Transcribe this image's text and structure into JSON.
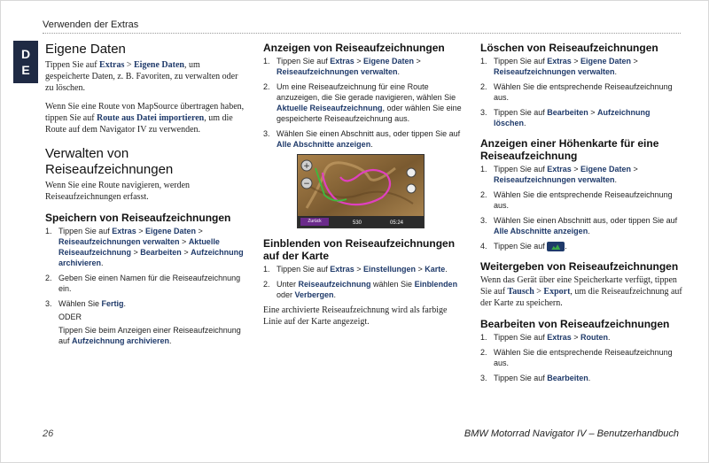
{
  "header": {
    "section": "Verwenden der Extras"
  },
  "lang_tab": {
    "line1": "D",
    "line2": "E"
  },
  "col1": {
    "h_eigene": "Eigene Daten",
    "p1_a": "Tippen Sie auf ",
    "p1_k1": "Extras",
    "p1_sep": " > ",
    "p1_k2": "Eigene Daten",
    "p1_b": ", um gespeicherte Daten, z. B. Favoriten, zu verwalten oder zu löschen.",
    "p2_a": "Wenn Sie eine Route von MapSource übertragen haben, tippen Sie auf ",
    "p2_k": "Route aus Datei importieren",
    "p2_b": ", um die Route auf dem Navigator IV zu verwenden.",
    "h_verwalten": "Verwalten von Reiseaufzeichnungen",
    "p3": "Wenn Sie eine Route navigieren, werden Reiseaufzeichnungen erfasst.",
    "h_speichern": "Speichern von Reiseaufzeichnungen",
    "s1_n": "1.",
    "s1_a": "Tippen Sie auf ",
    "s1_k1": "Extras",
    "s1_k2": "Eigene Daten",
    "s1_k3": "Reiseaufzeichnungen verwalten",
    "s1_k4": "Aktuelle Reiseaufzeichnung",
    "s1_k5": "Bearbeiten",
    "s1_k6": "Aufzeichnung archivieren",
    "s1_end": ".",
    "s2_n": "2.",
    "s2": "Geben Sie einen Namen für die Reiseaufzeichnung ein.",
    "s3_n": "3.",
    "s3_a": "Wählen Sie ",
    "s3_k": "Fertig",
    "s3_end": ".",
    "s3_oder": "ODER",
    "s3_alt_a": "Tippen Sie beim Anzeigen einer Reiseaufzeichnung auf ",
    "s3_alt_k": "Aufzeichnung archivieren",
    "s3_alt_end": "."
  },
  "col2": {
    "h_anzeigen": "Anzeigen von Reiseaufzeichnungen",
    "a1_n": "1.",
    "a1_a": "Tippen Sie auf ",
    "a1_k1": "Extras",
    "a1_k2": "Eigene Daten",
    "a1_k3": "Reiseaufzeichnungen verwalten",
    "a1_end": ".",
    "a2_n": "2.",
    "a2_a": "Um eine Reiseaufzeichnung für eine Route anzuzeigen, die Sie gerade navigieren, wählen Sie ",
    "a2_k": "Aktuelle Reiseaufzeichnung",
    "a2_b": ", oder wählen Sie eine gespeicherte Reiseaufzeichnung aus.",
    "a3_n": "3.",
    "a3_a": "Wählen Sie einen Abschnitt aus, oder tippen Sie auf ",
    "a3_k": "Alle Abschnitte anzeigen",
    "a3_end": ".",
    "map_btn": "Zurück",
    "map_val1": "530",
    "map_val2": "05:24",
    "h_einblenden": "Einblenden von Reiseaufzeichnungen auf der Karte",
    "e1_n": "1.",
    "e1_a": "Tippen Sie auf ",
    "e1_k1": "Extras",
    "e1_k2": "Einstellungen",
    "e1_k3": "Karte",
    "e1_end": ".",
    "e2_n": "2.",
    "e2_a": "Unter ",
    "e2_k1": "Reiseaufzeichnung",
    "e2_b": " wählen Sie ",
    "e2_k2": "Einblenden",
    "e2_c": " oder ",
    "e2_k3": "Verbergen",
    "e2_end": ".",
    "p_archiv": "Eine archivierte Reiseaufzeichnung wird als farbige Linie auf der Karte angezeigt."
  },
  "col3": {
    "h_loeschen": "Löschen von Reiseaufzeichnungen",
    "l1_n": "1.",
    "l1_a": "Tippen Sie auf ",
    "l1_k1": "Extras",
    "l1_k2": "Eigene Daten",
    "l1_k3": "Reiseaufzeichnungen verwalten",
    "l1_end": ".",
    "l2_n": "2.",
    "l2": "Wählen Sie die entsprechende Reiseaufzeichnung aus.",
    "l3_n": "3.",
    "l3_a": "Tippen Sie auf ",
    "l3_k1": "Bearbeiten",
    "l3_k2": "Aufzeichnung löschen",
    "l3_end": ".",
    "h_hoehe": "Anzeigen einer Höhenkarte für eine Reiseaufzeichnung",
    "h1_n": "1.",
    "h1_a": "Tippen Sie auf ",
    "h1_k1": "Extras",
    "h1_k2": "Eigene Daten",
    "h1_k3": "Reiseaufzeichnungen verwalten",
    "h1_end": ".",
    "h2_n": "2.",
    "h2": "Wählen Sie die entsprechende Reiseaufzeichnung aus.",
    "h3_n": "3.",
    "h3_a": "Wählen Sie einen Abschnitt aus, oder tippen Sie auf ",
    "h3_k": "Alle Abschnitte anzeigen",
    "h3_end": ".",
    "h4_n": "4.",
    "h4_a": "Tippen Sie auf ",
    "h4_end": ".",
    "h_weiter": "Weitergeben von Reiseaufzeichnungen",
    "p_weiter_a": "Wenn das Gerät über eine Speicherkarte verfügt, tippen Sie auf ",
    "p_weiter_k1": "Tausch",
    "p_weiter_k2": "Export",
    "p_weiter_b": ", um die Reiseaufzeichnung auf der Karte zu speichern.",
    "h_bearbeiten": "Bearbeiten von Reiseaufzeichnungen",
    "b1_n": "1.",
    "b1_a": "Tippen Sie auf ",
    "b1_k1": "Extras",
    "b1_k2": "Routen",
    "b1_end": ".",
    "b2_n": "2.",
    "b2": "Wählen Sie die entsprechende Reiseaufzeichnung aus.",
    "b3_n": "3.",
    "b3_a": "Tippen Sie auf ",
    "b3_k": "Bearbeiten",
    "b3_end": "."
  },
  "footer": {
    "page_number": "26",
    "title": "BMW Motorrad Navigator IV – Benutzerhandbuch"
  },
  "sep": " > "
}
